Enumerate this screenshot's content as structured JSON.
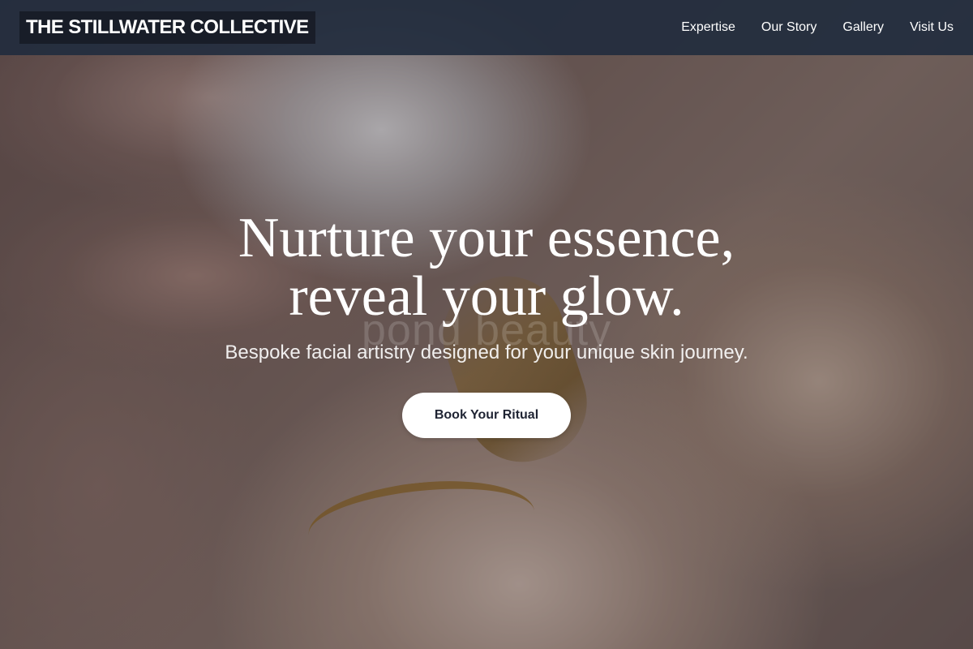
{
  "nav": {
    "brand": "THE STILLWATER COLLECTIVE",
    "links": [
      "Expertise",
      "Our Story",
      "Gallery",
      "Visit Us"
    ]
  },
  "hero": {
    "headline_line1": "Nurture your essence,",
    "headline_line2": "reveal your glow.",
    "subheadline": "Bespoke facial artistry designed for your unique skin journey.",
    "cta_label": "Book Your Ritual",
    "watermark": "pond beauty"
  },
  "colors": {
    "nav_background": "#222c3e",
    "cta_text": "#1f2433",
    "text": "#ffffff"
  }
}
